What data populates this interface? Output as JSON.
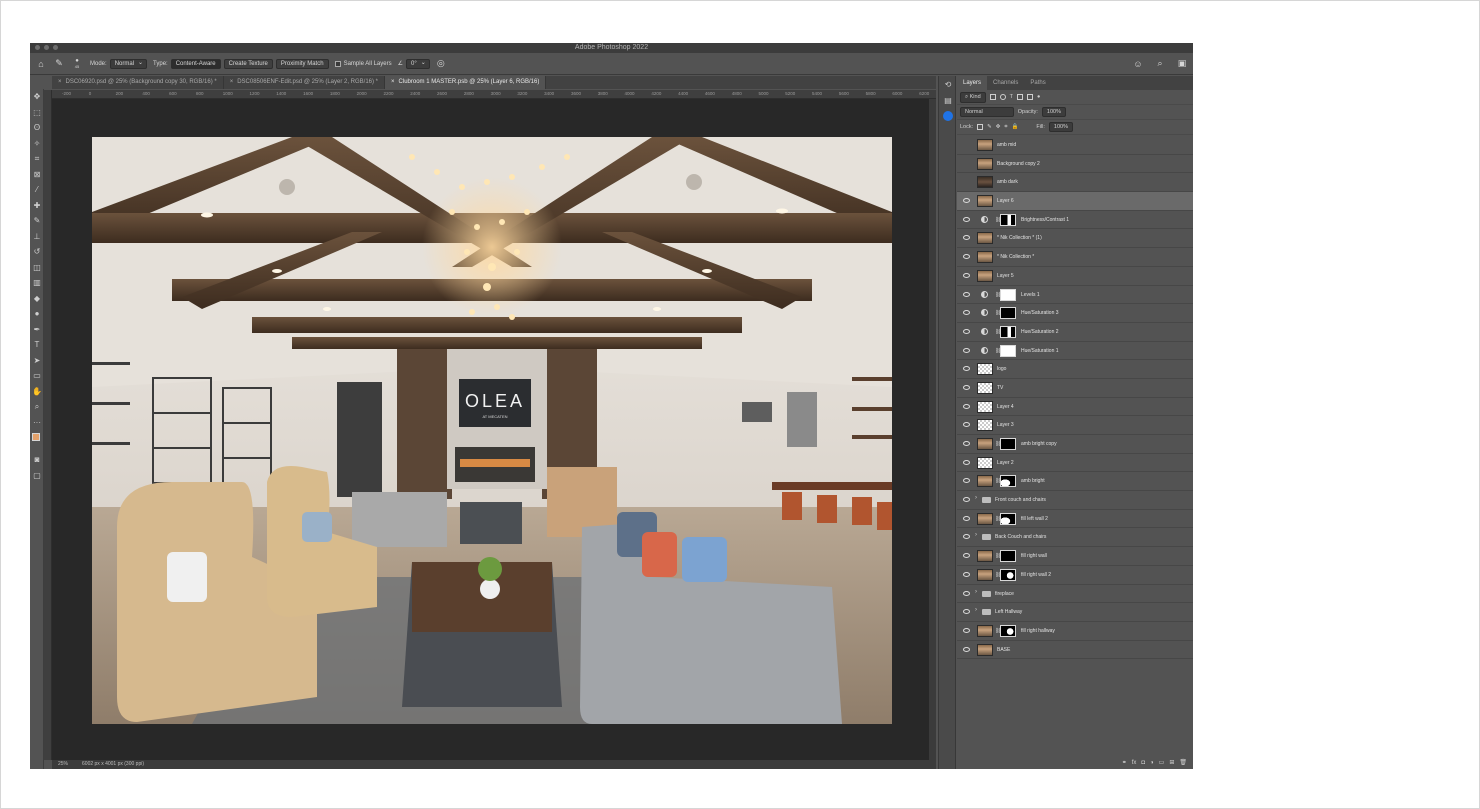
{
  "app": {
    "title": "Adobe Photoshop 2022"
  },
  "options_bar": {
    "brush_size": "45",
    "mode_label": "Mode:",
    "mode_value": "Normal",
    "type_label": "Type:",
    "type_buttons": [
      "Content-Aware",
      "Create Texture",
      "Proximity Match"
    ],
    "sample_all_layers": "Sample All Layers",
    "angle": "0°"
  },
  "tabs": [
    {
      "label": "DSC06920.psd @ 25% (Background copy 30, RGB/16) *",
      "active": false
    },
    {
      "label": "DSC08506ENF-Edit.psd @ 25% (Layer 2, RGB/16) *",
      "active": false
    },
    {
      "label": "Clubroom 1 MASTER.psb @ 25% (Layer 6, RGB/16)",
      "active": true
    }
  ],
  "ruler": [
    "-200",
    "0",
    "200",
    "400",
    "600",
    "800",
    "1000",
    "1200",
    "1400",
    "1600",
    "1800",
    "2000",
    "2200",
    "2400",
    "2600",
    "2800",
    "3000",
    "3200",
    "3400",
    "3600",
    "3800",
    "4000",
    "4200",
    "4400",
    "4600",
    "4800",
    "5000",
    "5200",
    "5400",
    "5600",
    "5800",
    "6000",
    "6200"
  ],
  "status": {
    "zoom": "25%",
    "doc_size": "6002 px x 4001 px (300 ppi)"
  },
  "photo": {
    "sign_main": "OLEA",
    "sign_sub": "AT MECATEN"
  },
  "panel": {
    "tabs": [
      "Layers",
      "Channels",
      "Paths"
    ],
    "filter_kind": "Kind",
    "blend_mode": "Normal",
    "opacity_label": "Opacity:",
    "opacity_value": "100%",
    "lock_label": "Lock:",
    "fill_label": "Fill:",
    "fill_value": "100%"
  },
  "layers": [
    {
      "name": "amb mid",
      "visible": false,
      "kind": "pixel",
      "thumb": "photo"
    },
    {
      "name": "Background copy 2",
      "visible": false,
      "kind": "pixel",
      "thumb": "photo"
    },
    {
      "name": "amb dark",
      "visible": false,
      "kind": "pixel",
      "thumb": "dark"
    },
    {
      "name": "Layer 6",
      "visible": true,
      "kind": "pixel",
      "thumb": "photo",
      "selected": true
    },
    {
      "name": "Brightness/Contrast 1",
      "visible": true,
      "kind": "adjustment",
      "mask": "mixed"
    },
    {
      "name": "* Nik Collection * (1)",
      "visible": true,
      "kind": "pixel",
      "thumb": "photo"
    },
    {
      "name": "* Nik Collection *",
      "visible": true,
      "kind": "pixel",
      "thumb": "photo"
    },
    {
      "name": "Layer 5",
      "visible": true,
      "kind": "pixel",
      "thumb": "photo"
    },
    {
      "name": "Levels 1",
      "visible": true,
      "kind": "adjustment",
      "mask": "white"
    },
    {
      "name": "Hue/Saturation 3",
      "visible": true,
      "kind": "adjustment",
      "mask": "black"
    },
    {
      "name": "Hue/Saturation 2",
      "visible": true,
      "kind": "adjustment",
      "mask": "mixed"
    },
    {
      "name": "Hue/Saturation 1",
      "visible": true,
      "kind": "adjustment",
      "mask": "white"
    },
    {
      "name": "logo",
      "visible": true,
      "kind": "pixel",
      "thumb": "check"
    },
    {
      "name": "TV",
      "visible": true,
      "kind": "pixel",
      "thumb": "check"
    },
    {
      "name": "Layer 4",
      "visible": true,
      "kind": "pixel",
      "thumb": "check"
    },
    {
      "name": "Layer 3",
      "visible": true,
      "kind": "pixel",
      "thumb": "check"
    },
    {
      "name": "amb bright copy",
      "visible": true,
      "kind": "masked",
      "thumb": "photo",
      "mask": "black"
    },
    {
      "name": "Layer 2",
      "visible": true,
      "kind": "pixel",
      "thumb": "check"
    },
    {
      "name": "amb bright",
      "visible": true,
      "kind": "masked",
      "thumb": "photo",
      "mask": "blob"
    },
    {
      "name": "Front couch and chairs",
      "visible": true,
      "kind": "group"
    },
    {
      "name": "fill left wall 2",
      "visible": true,
      "kind": "masked",
      "thumb": "photo",
      "mask": "blob"
    },
    {
      "name": "Back Couch and chairs",
      "visible": true,
      "kind": "group"
    },
    {
      "name": "fill right wall",
      "visible": true,
      "kind": "masked",
      "thumb": "photo",
      "mask": "black"
    },
    {
      "name": "fill right wall 2",
      "visible": true,
      "kind": "masked",
      "thumb": "photo",
      "mask": "spot"
    },
    {
      "name": "fireplace",
      "visible": true,
      "kind": "group"
    },
    {
      "name": "Left Hallway",
      "visible": true,
      "kind": "group"
    },
    {
      "name": "fill right hallway",
      "visible": true,
      "kind": "masked",
      "thumb": "photo",
      "mask": "spot"
    },
    {
      "name": "BASE",
      "visible": true,
      "kind": "pixel",
      "thumb": "photo"
    }
  ]
}
